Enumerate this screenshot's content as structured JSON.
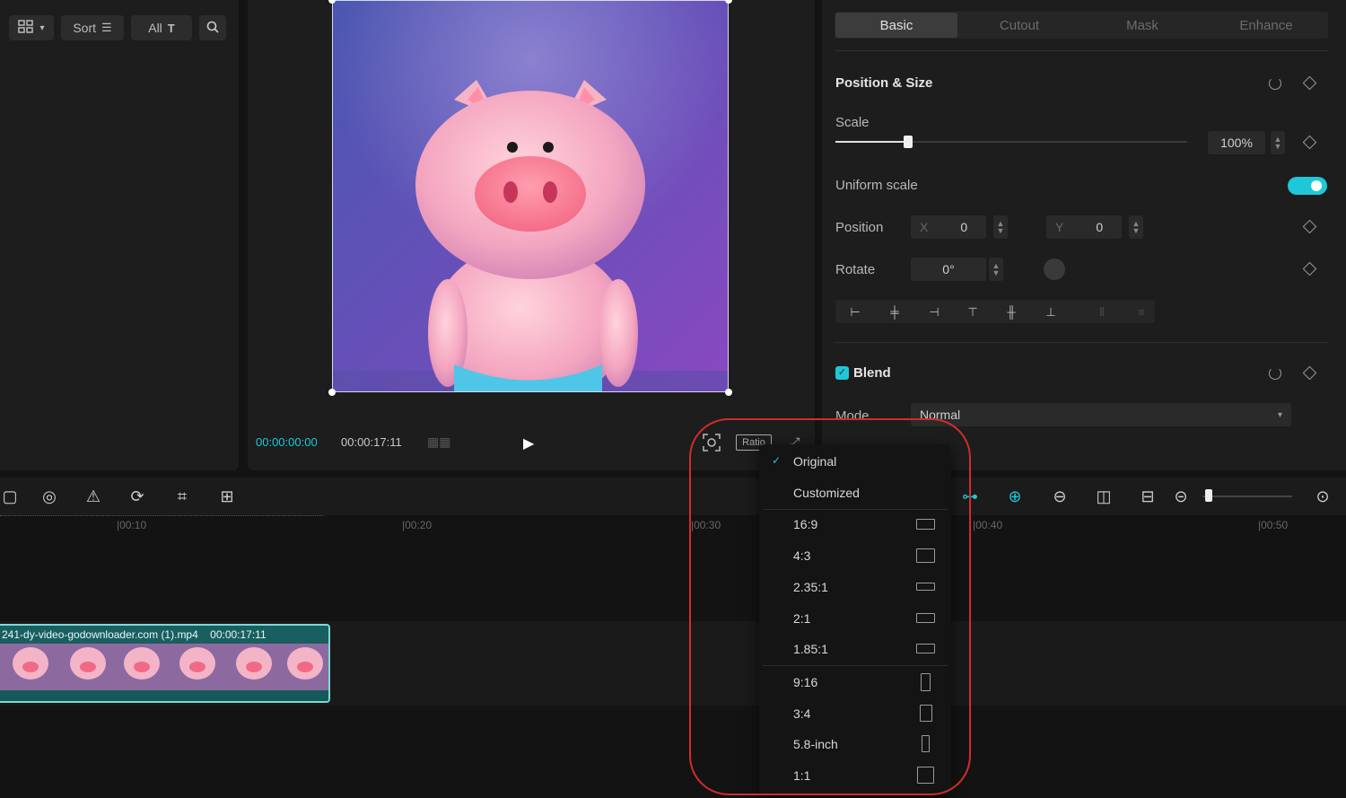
{
  "media_toolbar": {
    "sort_label": "Sort",
    "all_label": "All"
  },
  "preview": {
    "current_time": "00:00:00:00",
    "total_time": "00:00:17:11",
    "ratio_button": "Ratio"
  },
  "props": {
    "tabs": [
      "Basic",
      "Cutout",
      "Mask",
      "Enhance"
    ],
    "active_tab": "Basic",
    "position_size_title": "Position & Size",
    "scale_label": "Scale",
    "scale_value": "100%",
    "uniform_scale_label": "Uniform scale",
    "uniform_scale_on": true,
    "position_label": "Position",
    "x_label": "X",
    "x_value": "0",
    "y_label": "Y",
    "y_value": "0",
    "rotate_label": "Rotate",
    "rotate_value": "0°",
    "blend_title": "Blend",
    "mode_label": "Mode",
    "mode_value": "Normal"
  },
  "timeline": {
    "ruler": [
      "|00:10",
      "|00:20",
      "|00:30",
      "|00:40",
      "|00:50"
    ],
    "clip_name": "241-dy-video-godownloader.com (1).mp4",
    "clip_duration": "00:00:17:11"
  },
  "ratio_menu": {
    "items": [
      "Original",
      "Customized"
    ],
    "landscape": [
      "16:9",
      "4:3",
      "2.35:1",
      "2:1",
      "1.85:1"
    ],
    "portrait": [
      "9:16",
      "3:4",
      "5.8-inch",
      "1:1"
    ],
    "selected": "Original"
  },
  "colors": {
    "accent": "#1ec8d8",
    "highlight_ring": "#d22c2c"
  }
}
